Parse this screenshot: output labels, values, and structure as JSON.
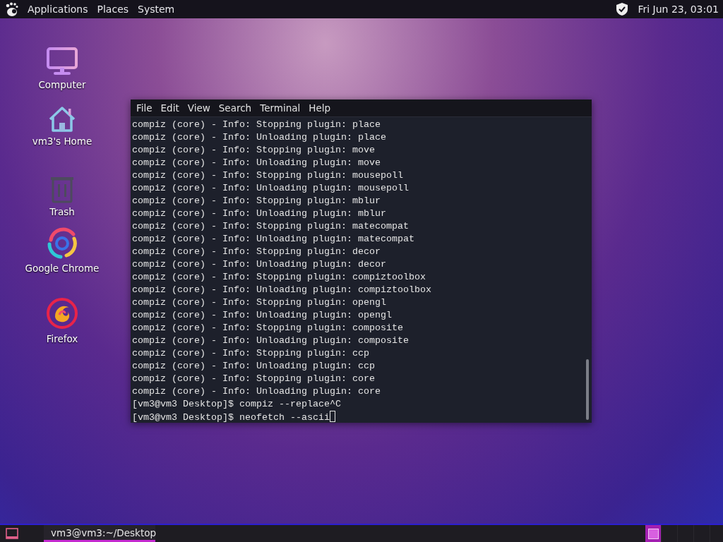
{
  "top_panel": {
    "menus": [
      "Applications",
      "Places",
      "System"
    ],
    "clock": "Fri Jun 23, 03:01"
  },
  "desktop_icons": [
    {
      "kind": "computer",
      "label": "Computer"
    },
    {
      "kind": "home",
      "label": "vm3's Home"
    },
    {
      "kind": "trash",
      "label": "Trash"
    },
    {
      "kind": "chrome",
      "label": "Google Chrome"
    },
    {
      "kind": "firefox",
      "label": "Firefox"
    }
  ],
  "terminal": {
    "menu": [
      "File",
      "Edit",
      "View",
      "Search",
      "Terminal",
      "Help"
    ],
    "lines": [
      "compiz (core) - Info: Stopping plugin: place",
      "compiz (core) - Info: Unloading plugin: place",
      "compiz (core) - Info: Stopping plugin: move",
      "compiz (core) - Info: Unloading plugin: move",
      "compiz (core) - Info: Stopping plugin: mousepoll",
      "compiz (core) - Info: Unloading plugin: mousepoll",
      "compiz (core) - Info: Stopping plugin: mblur",
      "compiz (core) - Info: Unloading plugin: mblur",
      "compiz (core) - Info: Stopping plugin: matecompat",
      "compiz (core) - Info: Unloading plugin: matecompat",
      "compiz (core) - Info: Stopping plugin: decor",
      "compiz (core) - Info: Unloading plugin: decor",
      "compiz (core) - Info: Stopping plugin: compiztoolbox",
      "compiz (core) - Info: Unloading plugin: compiztoolbox",
      "compiz (core) - Info: Stopping plugin: opengl",
      "compiz (core) - Info: Unloading plugin: opengl",
      "compiz (core) - Info: Stopping plugin: composite",
      "compiz (core) - Info: Unloading plugin: composite",
      "compiz (core) - Info: Stopping plugin: ccp",
      "compiz (core) - Info: Unloading plugin: ccp",
      "compiz (core) - Info: Stopping plugin: core",
      "compiz (core) - Info: Unloading plugin: core",
      "[vm3@vm3 Desktop]$ compiz --replace^C",
      "[vm3@vm3 Desktop]$ neofetch --ascii"
    ]
  },
  "taskbar": {
    "windows": [
      {
        "title": "vm3@vm3:~/Desktop",
        "selected": true
      }
    ],
    "workspaces": [
      {
        "selected": true
      },
      {
        "selected": false
      },
      {
        "selected": false
      },
      {
        "selected": false
      }
    ]
  }
}
